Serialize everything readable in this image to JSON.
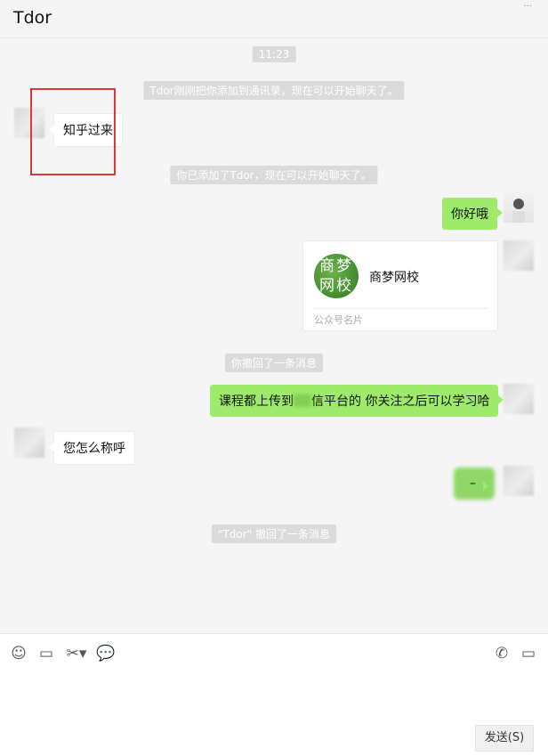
{
  "header": {
    "title": "Tdor"
  },
  "chat": {
    "time": "11:23",
    "sys_added_by_other": "Tdor刚刚把你添加到通讯录，现在可以开始聊天了。",
    "msg_in_1": "知乎过来",
    "sys_added_you": "你已添加了Tdor，现在可以开始聊天了。",
    "msg_out_1": "你好哦",
    "card": {
      "name": "商梦网校",
      "logo_text_1": "商梦",
      "logo_text_2": "网校",
      "type": "公众号名片"
    },
    "sys_recalled_you": "你撤回了一条消息",
    "msg_out_2a": "课程都上传到",
    "msg_out_2b": "信平台的  你关注之后可以学习哈",
    "msg_in_2": "您怎么称呼",
    "msg_out_3": "–",
    "sys_recalled_other": "\"Tdor\" 撤回了一条消息"
  },
  "toolbar": {
    "emoji_icon": "smile-icon",
    "file_icon": "folder-icon",
    "screenshot_icon": "scissors-icon",
    "chat_history_icon": "speech-bubble-icon",
    "voice_call_icon": "phone-icon",
    "video_call_icon": "video-camera-icon",
    "send_label": "发送(S)"
  },
  "colors": {
    "outgoing_bubble": "#9eea6a",
    "highlight_box": "#d9363e"
  }
}
